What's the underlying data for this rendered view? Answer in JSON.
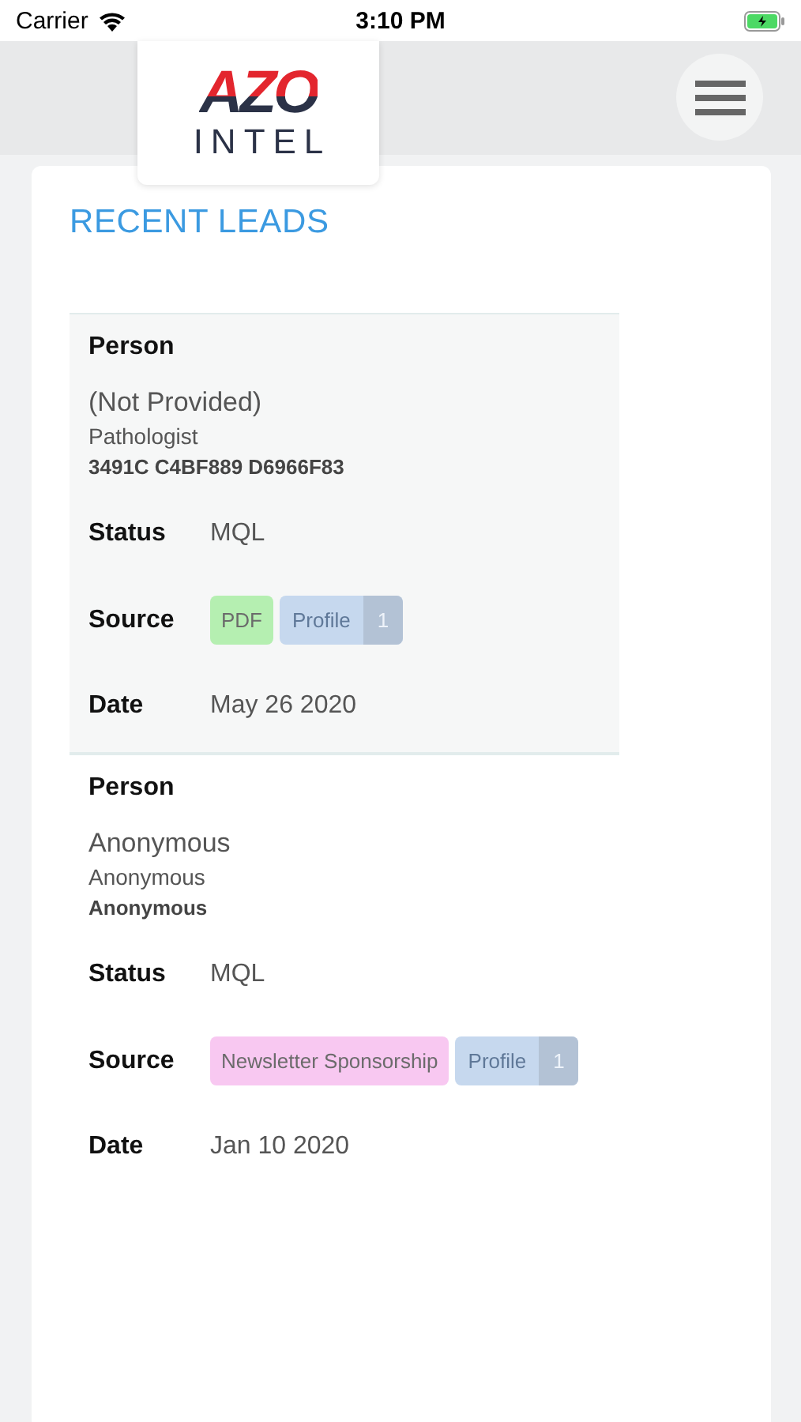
{
  "status_bar": {
    "carrier": "Carrier",
    "time": "3:10 PM"
  },
  "logo": {
    "top": "AZO",
    "bottom": "INTEL"
  },
  "section_title": "RECENT LEADS",
  "leads": [
    {
      "highlighted": true,
      "person_label": "Person",
      "name": "(Not Provided)",
      "role": "Pathologist",
      "id": "3491C C4BF889 D6966F83",
      "status_label": "Status",
      "status": "MQL",
      "source_label": "Source",
      "tags": [
        {
          "kind": "tag",
          "text": "PDF",
          "color": "#b5efb1"
        },
        {
          "kind": "count",
          "text": "Profile",
          "count": "1",
          "color": "#c6d8ee"
        }
      ],
      "date_label": "Date",
      "date": "May 26 2020"
    },
    {
      "highlighted": false,
      "person_label": "Person",
      "name": "Anonymous",
      "role": "Anonymous",
      "id": "Anonymous",
      "status_label": "Status",
      "status": "MQL",
      "source_label": "Source",
      "tags": [
        {
          "kind": "tag",
          "text": "Newsletter Sponsorship",
          "color": "#f8c8f1"
        },
        {
          "kind": "count",
          "text": "Profile",
          "count": "1",
          "color": "#c6d8ee"
        }
      ],
      "date_label": "Date",
      "date": "Jan 10 2020"
    }
  ]
}
